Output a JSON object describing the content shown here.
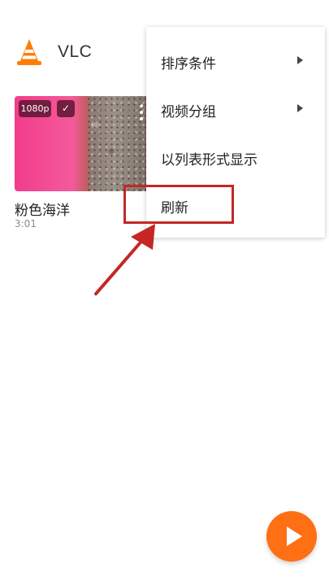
{
  "app_bar": {
    "title": "VLC",
    "logo_icon": "vlc-cone-icon"
  },
  "video": {
    "resolution_badge": "1080p",
    "check_icon": "checkmark-icon",
    "check_glyph": "✓",
    "title": "粉色海洋",
    "duration": "3:01",
    "more_icon": "more-vertical-icon"
  },
  "menu": {
    "items": [
      {
        "label": "排序条件",
        "has_submenu": true
      },
      {
        "label": "视频分组",
        "has_submenu": true
      },
      {
        "label": "以列表形式显示",
        "has_submenu": false
      },
      {
        "label": "刷新",
        "has_submenu": false
      }
    ]
  },
  "annotation": {
    "highlight_color": "#c62626",
    "target": "刷新"
  },
  "fab": {
    "icon": "play-icon",
    "color": "#ff6f14"
  }
}
